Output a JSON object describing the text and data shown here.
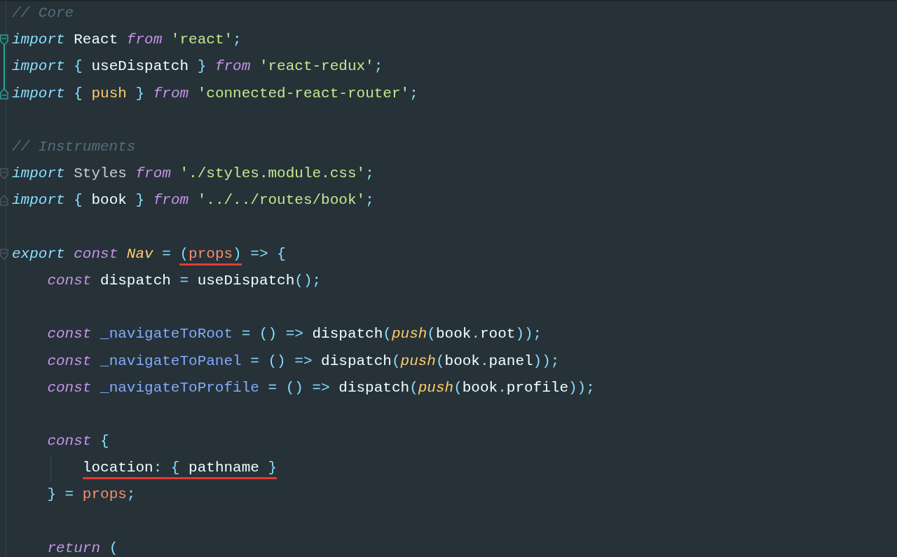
{
  "lines": [
    {
      "kind": "code",
      "tokens": [
        {
          "text": "// Core",
          "kind": "comment"
        }
      ]
    },
    {
      "kind": "fold-start",
      "highlighted": true,
      "tokens": [
        {
          "text": "import",
          "kind": "module"
        },
        {
          "text": " React ",
          "kind": "ident"
        },
        {
          "text": "from",
          "kind": "keyword"
        },
        {
          "text": " 'react'",
          "kind": "string"
        },
        {
          "text": ";",
          "kind": "punct"
        }
      ]
    },
    {
      "kind": "fold-middle",
      "highlighted": true,
      "tokens": [
        {
          "text": "import",
          "kind": "module"
        },
        {
          "text": " { ",
          "kind": "punct"
        },
        {
          "text": "useDispatch",
          "kind": "ident"
        },
        {
          "text": " } ",
          "kind": "punct"
        },
        {
          "text": "from",
          "kind": "keyword"
        },
        {
          "text": " 'react-redux'",
          "kind": "string"
        },
        {
          "text": ";",
          "kind": "punct"
        }
      ]
    },
    {
      "kind": "fold-end",
      "highlighted": true,
      "tokens": [
        {
          "text": "import",
          "kind": "module"
        },
        {
          "text": " { ",
          "kind": "punct"
        },
        {
          "text": "push",
          "kind": "named"
        },
        {
          "text": " } ",
          "kind": "punct"
        },
        {
          "text": "from",
          "kind": "keyword"
        },
        {
          "text": " 'connected-react-router'",
          "kind": "string"
        },
        {
          "text": ";",
          "kind": "punct"
        }
      ]
    },
    {
      "kind": "blank"
    },
    {
      "kind": "code",
      "tokens": [
        {
          "text": "// Instruments",
          "kind": "comment"
        }
      ]
    },
    {
      "kind": "fold-start",
      "highlighted": false,
      "tokens": [
        {
          "text": "import",
          "kind": "module"
        },
        {
          "text": " Styles ",
          "kind": "dim"
        },
        {
          "text": "from",
          "kind": "keyword"
        },
        {
          "text": " './styles.module.css'",
          "kind": "string"
        },
        {
          "text": ";",
          "kind": "punct"
        }
      ]
    },
    {
      "kind": "fold-end",
      "highlighted": false,
      "tokens": [
        {
          "text": "import",
          "kind": "module"
        },
        {
          "text": " { ",
          "kind": "punct"
        },
        {
          "text": "book",
          "kind": "ident"
        },
        {
          "text": " } ",
          "kind": "punct"
        },
        {
          "text": "from",
          "kind": "keyword"
        },
        {
          "text": " '../../routes/book'",
          "kind": "string"
        },
        {
          "text": ";",
          "kind": "punct"
        }
      ]
    },
    {
      "kind": "blank"
    },
    {
      "kind": "fold-start",
      "highlighted": false,
      "tokens": [
        {
          "text": "export",
          "kind": "module"
        },
        {
          "text": " const",
          "kind": "keyword"
        },
        {
          "text": " Nav",
          "kind": "class"
        },
        {
          "text": " = ",
          "kind": "punct"
        },
        {
          "kind": "underline",
          "tokens": [
            {
              "text": "(",
              "kind": "punct"
            },
            {
              "text": "props",
              "kind": "param"
            },
            {
              "text": ")",
              "kind": "punct"
            }
          ]
        },
        {
          "text": " => {",
          "kind": "punct"
        }
      ]
    },
    {
      "kind": "code",
      "tokens": [
        {
          "text": "    const",
          "kind": "keyword"
        },
        {
          "text": " dispatch ",
          "kind": "ident"
        },
        {
          "text": "=",
          "kind": "punct"
        },
        {
          "text": " useDispatch",
          "kind": "ident"
        },
        {
          "text": "();",
          "kind": "punct"
        }
      ]
    },
    {
      "kind": "blank"
    },
    {
      "kind": "code",
      "tokens": [
        {
          "text": "    const",
          "kind": "keyword"
        },
        {
          "text": " _navigateToRoot",
          "kind": "func"
        },
        {
          "text": " = () => ",
          "kind": "punct"
        },
        {
          "text": "dispatch",
          "kind": "ident"
        },
        {
          "text": "(",
          "kind": "punct"
        },
        {
          "text": "push",
          "kind": "call"
        },
        {
          "text": "(",
          "kind": "punct"
        },
        {
          "text": "book",
          "kind": "ident"
        },
        {
          "text": ".",
          "kind": "punct"
        },
        {
          "text": "root",
          "kind": "ident"
        },
        {
          "text": "));",
          "kind": "punct"
        }
      ]
    },
    {
      "kind": "code",
      "tokens": [
        {
          "text": "    const",
          "kind": "keyword"
        },
        {
          "text": " _navigateToPanel",
          "kind": "func"
        },
        {
          "text": " = () => ",
          "kind": "punct"
        },
        {
          "text": "dispatch",
          "kind": "ident"
        },
        {
          "text": "(",
          "kind": "punct"
        },
        {
          "text": "push",
          "kind": "call"
        },
        {
          "text": "(",
          "kind": "punct"
        },
        {
          "text": "book",
          "kind": "ident"
        },
        {
          "text": ".",
          "kind": "punct"
        },
        {
          "text": "panel",
          "kind": "ident"
        },
        {
          "text": "));",
          "kind": "punct"
        }
      ]
    },
    {
      "kind": "code",
      "tokens": [
        {
          "text": "    const",
          "kind": "keyword"
        },
        {
          "text": " _navigateToProfile",
          "kind": "func"
        },
        {
          "text": " = () => ",
          "kind": "punct"
        },
        {
          "text": "dispatch",
          "kind": "ident"
        },
        {
          "text": "(",
          "kind": "punct"
        },
        {
          "text": "push",
          "kind": "call"
        },
        {
          "text": "(",
          "kind": "punct"
        },
        {
          "text": "book",
          "kind": "ident"
        },
        {
          "text": ".",
          "kind": "punct"
        },
        {
          "text": "profile",
          "kind": "ident"
        },
        {
          "text": "));",
          "kind": "punct"
        }
      ]
    },
    {
      "kind": "blank"
    },
    {
      "kind": "code",
      "tokens": [
        {
          "text": "    const",
          "kind": "keyword"
        },
        {
          "text": " {",
          "kind": "punct"
        }
      ]
    },
    {
      "kind": "guide",
      "tokens": [
        {
          "kind": "underline",
          "tokens": [
            {
              "text": "        location",
              "kind": "ident"
            },
            {
              "text": ": { ",
              "kind": "punct"
            },
            {
              "text": "pathname",
              "kind": "ident"
            },
            {
              "text": " }",
              "kind": "punct"
            }
          ]
        }
      ]
    },
    {
      "kind": "code",
      "tokens": [
        {
          "text": "    } = ",
          "kind": "punct"
        },
        {
          "text": "props",
          "kind": "param"
        },
        {
          "text": ";",
          "kind": "punct"
        }
      ]
    },
    {
      "kind": "blank"
    },
    {
      "kind": "code",
      "tokens": [
        {
          "text": "    return",
          "kind": "keyword"
        },
        {
          "text": " (",
          "kind": "punct"
        }
      ]
    }
  ]
}
